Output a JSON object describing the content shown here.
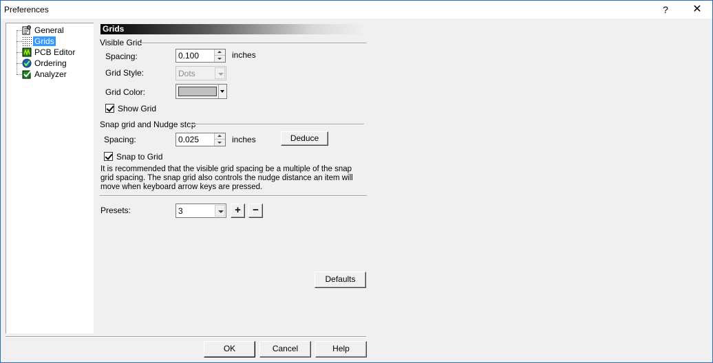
{
  "window": {
    "title": "Preferences",
    "help_glyph": "?",
    "close_glyph": "✕"
  },
  "tree": {
    "items": [
      {
        "label": "General",
        "icon": "general-icon"
      },
      {
        "label": "Grids",
        "icon": "grids-icon",
        "selected": true
      },
      {
        "label": "PCB Editor",
        "icon": "pcb-editor-icon"
      },
      {
        "label": "Ordering",
        "icon": "ordering-icon"
      },
      {
        "label": "Analyzer",
        "icon": "analyzer-icon"
      }
    ]
  },
  "panel": {
    "header": "Grids",
    "visible_grid": {
      "group_label": "Visible Grid",
      "spacing_label": "Spacing:",
      "spacing_value": "0.100",
      "units": "inches",
      "style_label": "Grid Style:",
      "style_value": "Dots",
      "color_label": "Grid Color:",
      "color_value": "#c0c0c0",
      "show_grid_label": "Show Grid",
      "show_grid_checked": true
    },
    "snap_grid": {
      "group_label": "Snap grid and Nudge step",
      "spacing_label": "Spacing:",
      "spacing_value": "0.025",
      "units": "inches",
      "deduce_label": "Deduce",
      "snap_label": "Snap to Grid",
      "snap_checked": true,
      "note": "It is recommended that the visible grid spacing be a multiple of the snap grid spacing. The snap grid also controls the nudge distance an item will move when keyboard arrow keys are pressed."
    },
    "presets": {
      "label": "Presets:",
      "value": "3",
      "add_label": "+",
      "remove_label": "−"
    },
    "defaults_label": "Defaults"
  },
  "footer": {
    "ok_label": "OK",
    "cancel_label": "Cancel",
    "help_label": "Help"
  }
}
